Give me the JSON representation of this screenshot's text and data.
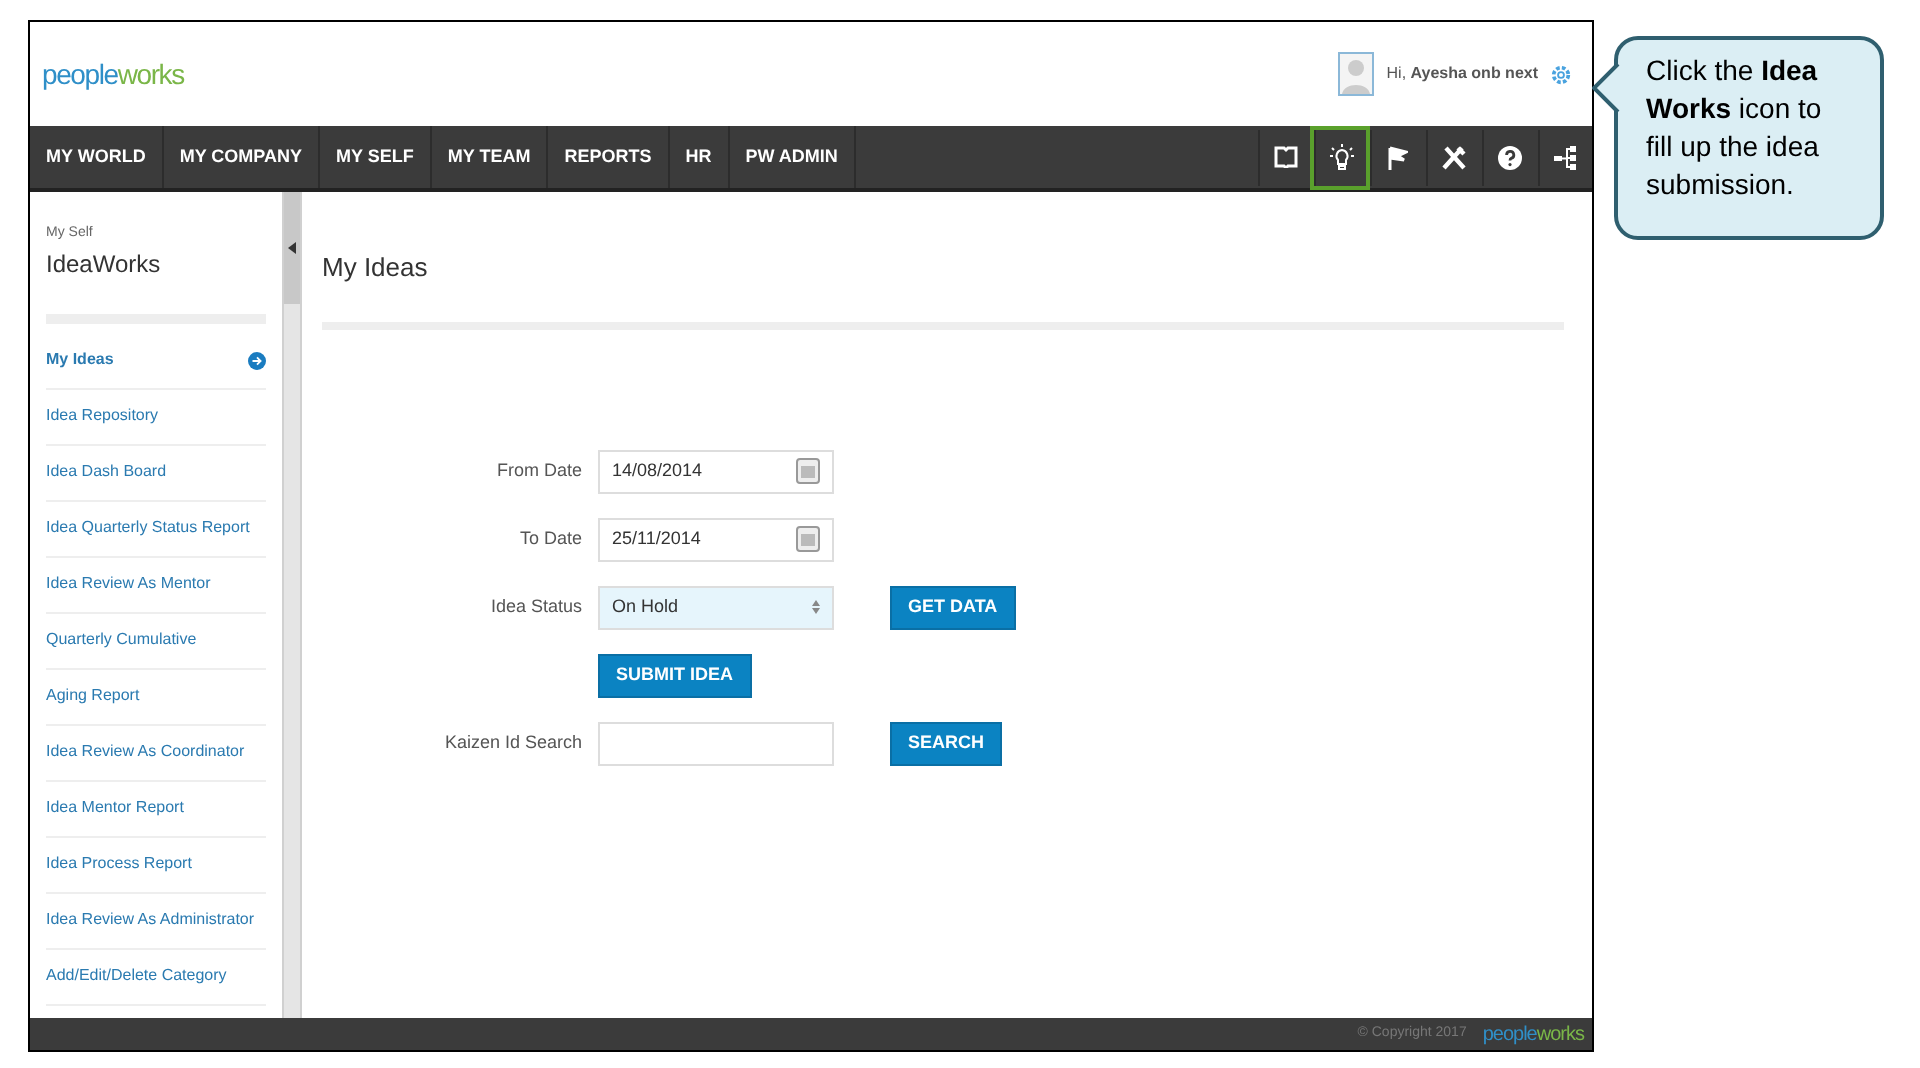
{
  "header": {
    "logo": "peopleworks",
    "greeting": "Hi, ",
    "user_name": "Ayesha onb next"
  },
  "nav": {
    "items": [
      {
        "label": "MY WORLD"
      },
      {
        "label": "MY COMPANY"
      },
      {
        "label": "MY SELF"
      },
      {
        "label": "MY TEAM"
      },
      {
        "label": "REPORTS"
      },
      {
        "label": "HR"
      },
      {
        "label": "PW ADMIN"
      }
    ],
    "toolbar": [
      {
        "kind": "book",
        "highlighted": false
      },
      {
        "kind": "bulb",
        "highlighted": true
      },
      {
        "kind": "flag",
        "highlighted": false
      },
      {
        "kind": "tools",
        "highlighted": false
      },
      {
        "kind": "help",
        "highlighted": false
      },
      {
        "kind": "share",
        "highlighted": false
      }
    ]
  },
  "sidebar": {
    "section": "My Self",
    "title": "IdeaWorks",
    "items": [
      {
        "label": "My Ideas",
        "selected": true
      },
      {
        "label": "Idea Repository",
        "selected": false
      },
      {
        "label": "Idea Dash Board",
        "selected": false
      },
      {
        "label": "Idea Quarterly Status Report",
        "selected": false
      },
      {
        "label": "Idea Review As Mentor",
        "selected": false
      },
      {
        "label": "Quarterly Cumulative",
        "selected": false
      },
      {
        "label": "Aging Report",
        "selected": false
      },
      {
        "label": "Idea Review As Coordinator",
        "selected": false
      },
      {
        "label": "Idea Mentor Report",
        "selected": false
      },
      {
        "label": "Idea Process Report",
        "selected": false
      },
      {
        "label": "Idea Review As Administrator",
        "selected": false
      },
      {
        "label": "Add/Edit/Delete Category",
        "selected": false
      }
    ]
  },
  "main": {
    "title": "My Ideas",
    "from_date": {
      "label": "From Date",
      "value": "14/08/2014"
    },
    "to_date": {
      "label": "To Date",
      "value": "25/11/2014"
    },
    "idea_status": {
      "label": "Idea Status",
      "value": "On Hold"
    },
    "get_data_button": "GET DATA",
    "submit_button": "SUBMIT IDEA",
    "kaizen_search": {
      "label": "Kaizen Id Search"
    },
    "search_button": "SEARCH"
  },
  "footer": {
    "copyright": "© Copyright 2017",
    "logo": "peopleworks"
  },
  "callout": {
    "text": "Click the **Idea Works** icon to fill up the idea submission."
  }
}
